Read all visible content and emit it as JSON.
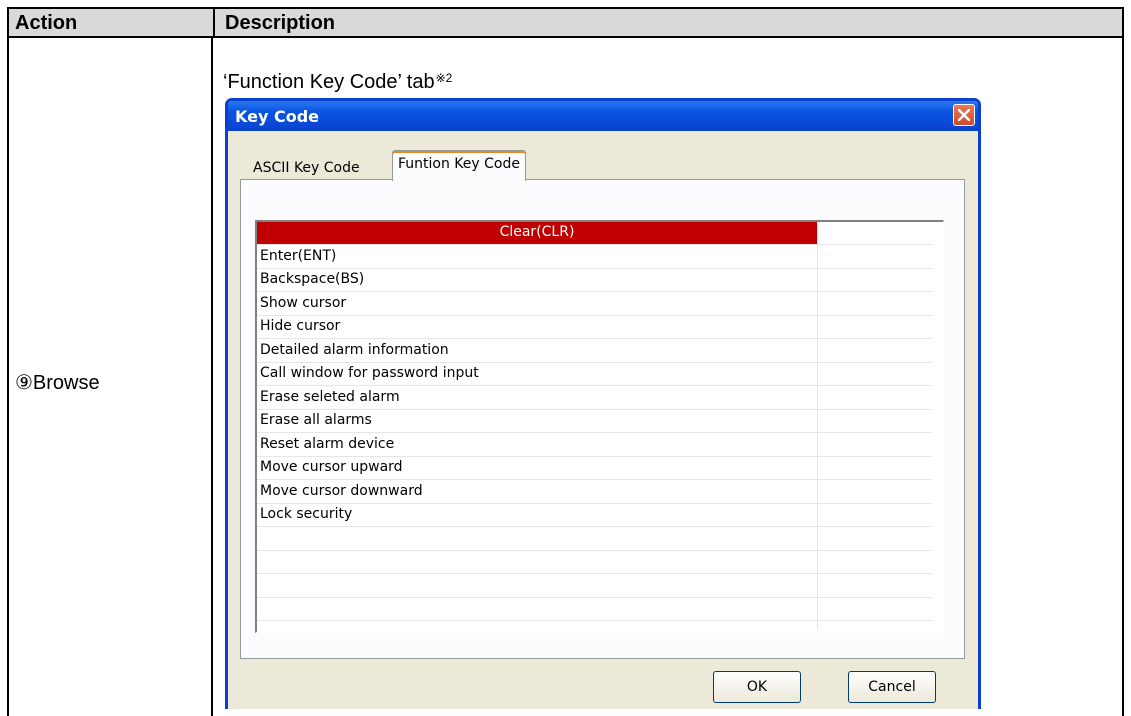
{
  "table": {
    "header_action": "Action",
    "header_description": "Description",
    "action_cell": "⑨Browse",
    "description_caption": "‘Function Key Code’ tab",
    "caption_note": "※2"
  },
  "dialog": {
    "title": "Key Code",
    "tabs": [
      "ASCII Key Code",
      "Funtion Key Code"
    ],
    "active_tab": "Funtion Key Code",
    "list_items": [
      "Clear(CLR)",
      "Enter(ENT)",
      "Backspace(BS)",
      "Show cursor",
      "Hide cursor",
      "Detailed alarm information",
      "Call window for password input",
      "Erase seleted alarm",
      "Erase all alarms",
      "Reset alarm device",
      "Move cursor upward",
      "Move cursor downward",
      "Lock security"
    ],
    "selected_item": "Clear(CLR)",
    "ok_label": "OK",
    "cancel_label": "Cancel"
  },
  "colors": {
    "selection": "#c00000",
    "titlebar": "#0a48d6",
    "header_bg": "#d9d9d9"
  }
}
